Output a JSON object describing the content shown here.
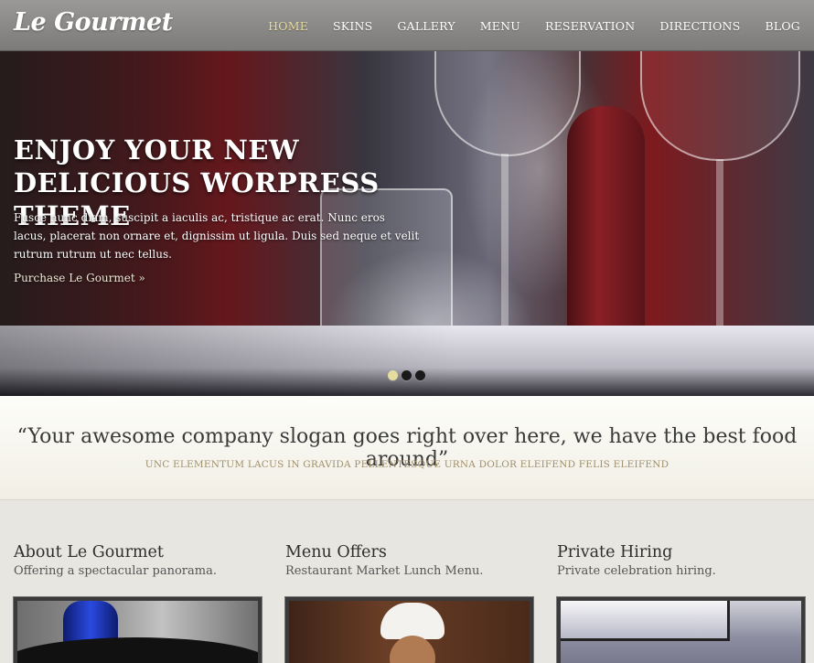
{
  "brand": {
    "logo": "Le Gourmet"
  },
  "nav": {
    "items": [
      {
        "label": "HOME",
        "active": true
      },
      {
        "label": "SKINS",
        "active": false
      },
      {
        "label": "GALLERY",
        "active": false
      },
      {
        "label": "MENU",
        "active": false
      },
      {
        "label": "RESERVATION",
        "active": false
      },
      {
        "label": "DIRECTIONS",
        "active": false
      },
      {
        "label": "BLOG",
        "active": false
      }
    ]
  },
  "hero": {
    "title": "ENJOY YOUR NEW DELICIOUS WORPRESS THEME",
    "text": "Fusce nunc diam, suscipit a iaculis ac, tristique ac erat. Nunc eros lacus, placerat non ornare et, dignissim ut ligula. Duis sed neque et velit rutrum rutrum ut nec tellus.",
    "link": "Purchase Le Gourmet »",
    "slides": 3,
    "active_slide": 1
  },
  "slogan": {
    "main": "“Your awesome company slogan goes right over here, we have the best food around”",
    "sub": "UNC ELEMENTUM LACUS IN GRAVIDA PELLENTESQUE URNA DOLOR ELEIFEND FELIS ELEIFEND"
  },
  "columns": [
    {
      "title": "About Le Gourmet",
      "subtitle": "Offering a spectacular panorama."
    },
    {
      "title": "Menu Offers",
      "subtitle": "Restaurant Market Lunch Menu."
    },
    {
      "title": "Private Hiring",
      "subtitle": "Private celebration hiring."
    }
  ],
  "colors": {
    "header": "#8a8987",
    "nav_active": "#e6dc9e",
    "slogan_sub": "#a08e6a"
  }
}
